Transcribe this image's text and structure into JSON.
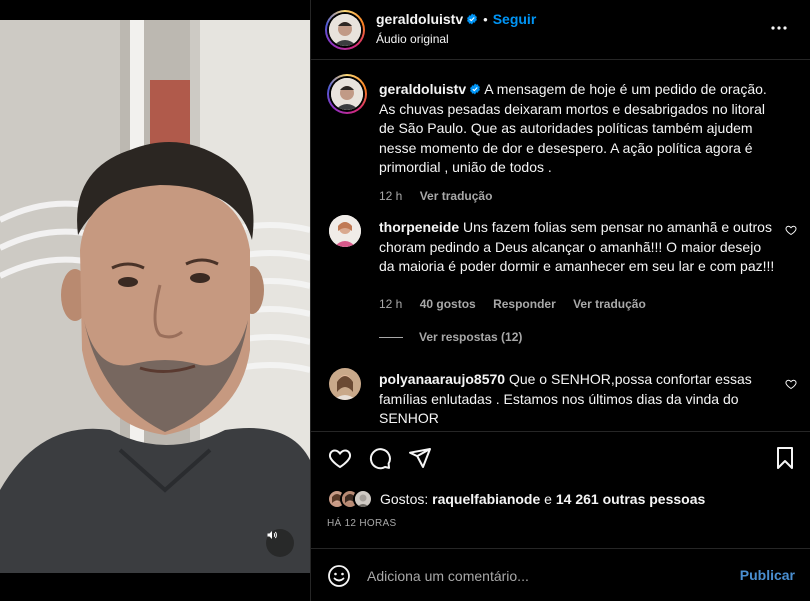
{
  "post": {
    "author": "geraldoluistv",
    "dot": "•",
    "follow_label": "Seguir",
    "audio_label": "Áudio original"
  },
  "caption": {
    "author": "geraldoluistv",
    "text": "A mensagem de hoje é um pedido de oração. As chuvas pesadas deixaram mortos e desabrigados no litoral de São Paulo. Que as autoridades políticas também ajudem nesse momento de dor e desespero. A ação política agora é primordial , união de todos .",
    "time": "12 h",
    "translate": "Ver tradução"
  },
  "comments": [
    {
      "author": "thorpeneide",
      "text": "Uns fazem folias sem pensar no amanhã e outros choram pedindo a Deus alcançar o amanhã!!! O maior desejo da maioria é poder dormir e amanhecer em seu lar e com paz!!!",
      "time": "12 h",
      "likes": "40 gostos",
      "reply": "Responder",
      "translate": "Ver tradução",
      "view_replies": "Ver respostas (12)"
    },
    {
      "author": "polyanaaraujo8570",
      "text": "Que o SENHOR,possa confortar essas famílias enlutadas . Estamos nos últimos dias da vinda do SENHOR"
    }
  ],
  "likes_summary": {
    "prefix": "Gostos:",
    "user": "raquelfabianode",
    "connector": "e",
    "others": "14 261 outras pessoas"
  },
  "time_ago": "HÁ 12 HORAS",
  "composer": {
    "placeholder": "Adiciona um comentário...",
    "publish_label": "Publicar"
  },
  "colors": {
    "accent": "#0095f6",
    "secondary_text": "#a8a8a8",
    "border": "#262626"
  },
  "icons": [
    "more-options-icon",
    "verified-icon",
    "heart-icon",
    "comment-icon",
    "share-icon",
    "bookmark-icon",
    "emoji-icon",
    "speaker-icon"
  ]
}
